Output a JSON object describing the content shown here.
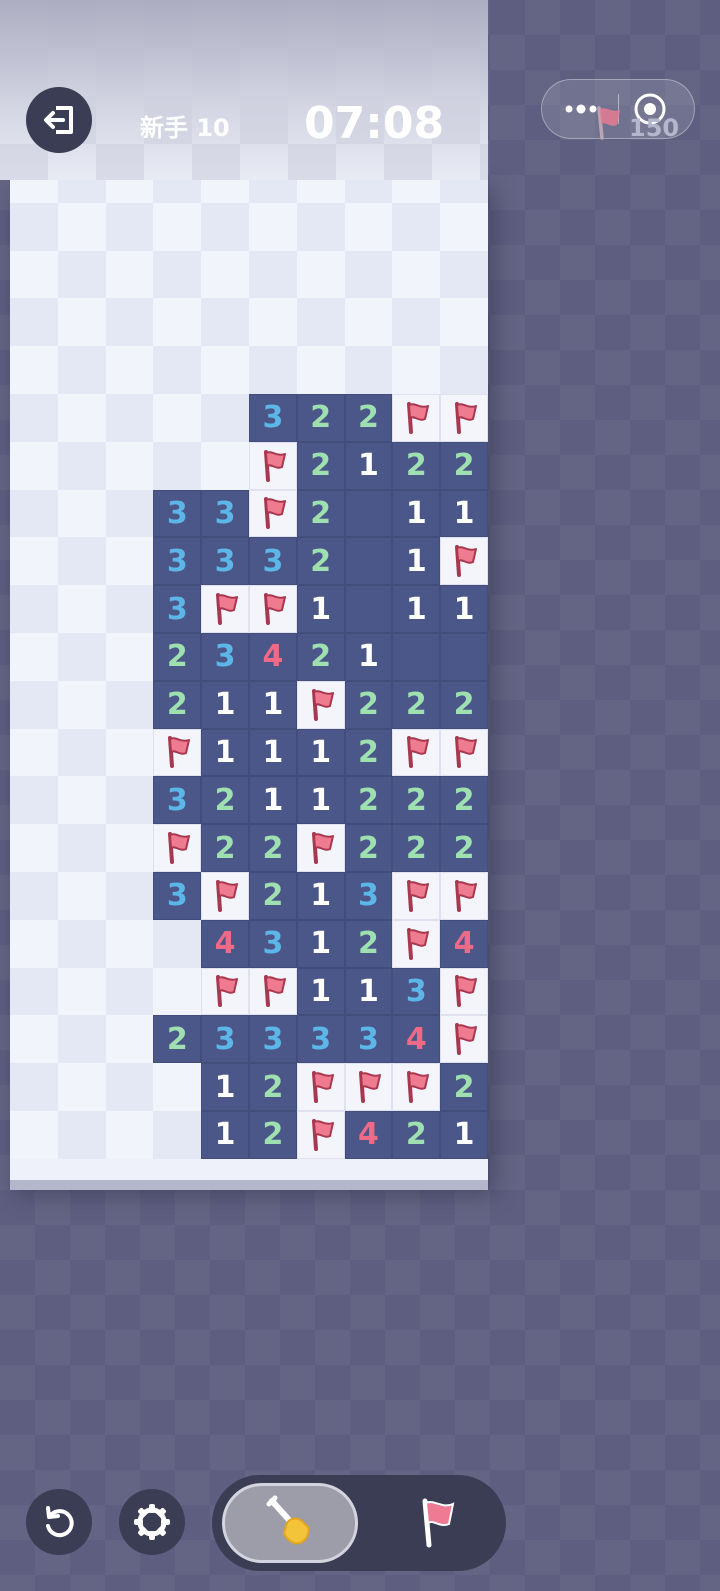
{
  "header": {
    "level_label": "新手 10",
    "timer": "07:08",
    "flags_remaining": "150"
  },
  "board": {
    "cols": 10,
    "rows": 21,
    "cells": [
      "..........",
      "..........",
      "..........",
      "..........",
      "..........",
      ".....322FF",
      ".....F2122",
      "...33F2 11",
      "...3332 1F",
      "...3FF1 11",
      "...23421  ",
      "...211F222",
      "...F1112FF",
      "...3211222",
      "...F22F222",
      "...3F213FF",
      "....4312F4",
      "....FF113F",
      "...233334F",
      "....12FFF2",
      "....12F421"
    ]
  },
  "colors": {
    "revealed": "#4c5789",
    "hidden_light": "#f2f4fc",
    "hidden_dark": "#e4e7f4",
    "flag": "#ef7b90",
    "num1": "#ffffff",
    "num2": "#9fe0b0",
    "num3": "#5cb6e8",
    "num4": "#ef6a86",
    "background": "#5e5f80"
  },
  "icons": {
    "exit": "exit-door-icon",
    "more": "more-dots-icon",
    "target": "target-circle-icon",
    "restart": "restart-icon",
    "settings": "gear-icon",
    "dig": "shovel-icon",
    "flag": "flag-icon"
  }
}
